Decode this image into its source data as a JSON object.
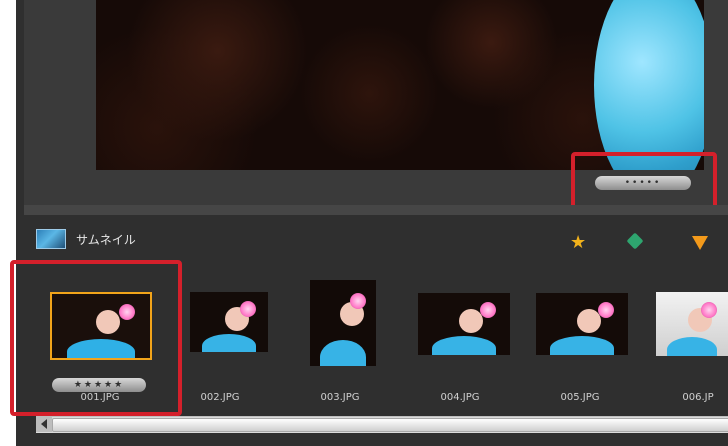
{
  "viewer": {
    "rating_label": "•••••"
  },
  "thumbnail_panel": {
    "title": "サムネイル",
    "icons": [
      "thumbnail-panel-icon",
      "star-icon",
      "tag-icon",
      "filter-icon"
    ],
    "thumbnails": [
      {
        "label": "001.JPG",
        "rating": "★★★★★"
      },
      {
        "label": "002.JPG"
      },
      {
        "label": "003.JPG"
      },
      {
        "label": "004.JPG"
      },
      {
        "label": "005.JPG"
      },
      {
        "label": "006.JP"
      }
    ]
  },
  "colors": {
    "app_bg": "#2f2f2f",
    "highlight": "#d4202b",
    "selected_border": "#f2a41a",
    "star": "#f2b21b",
    "tag": "#2ea56f",
    "filter": "#f39a1b"
  }
}
